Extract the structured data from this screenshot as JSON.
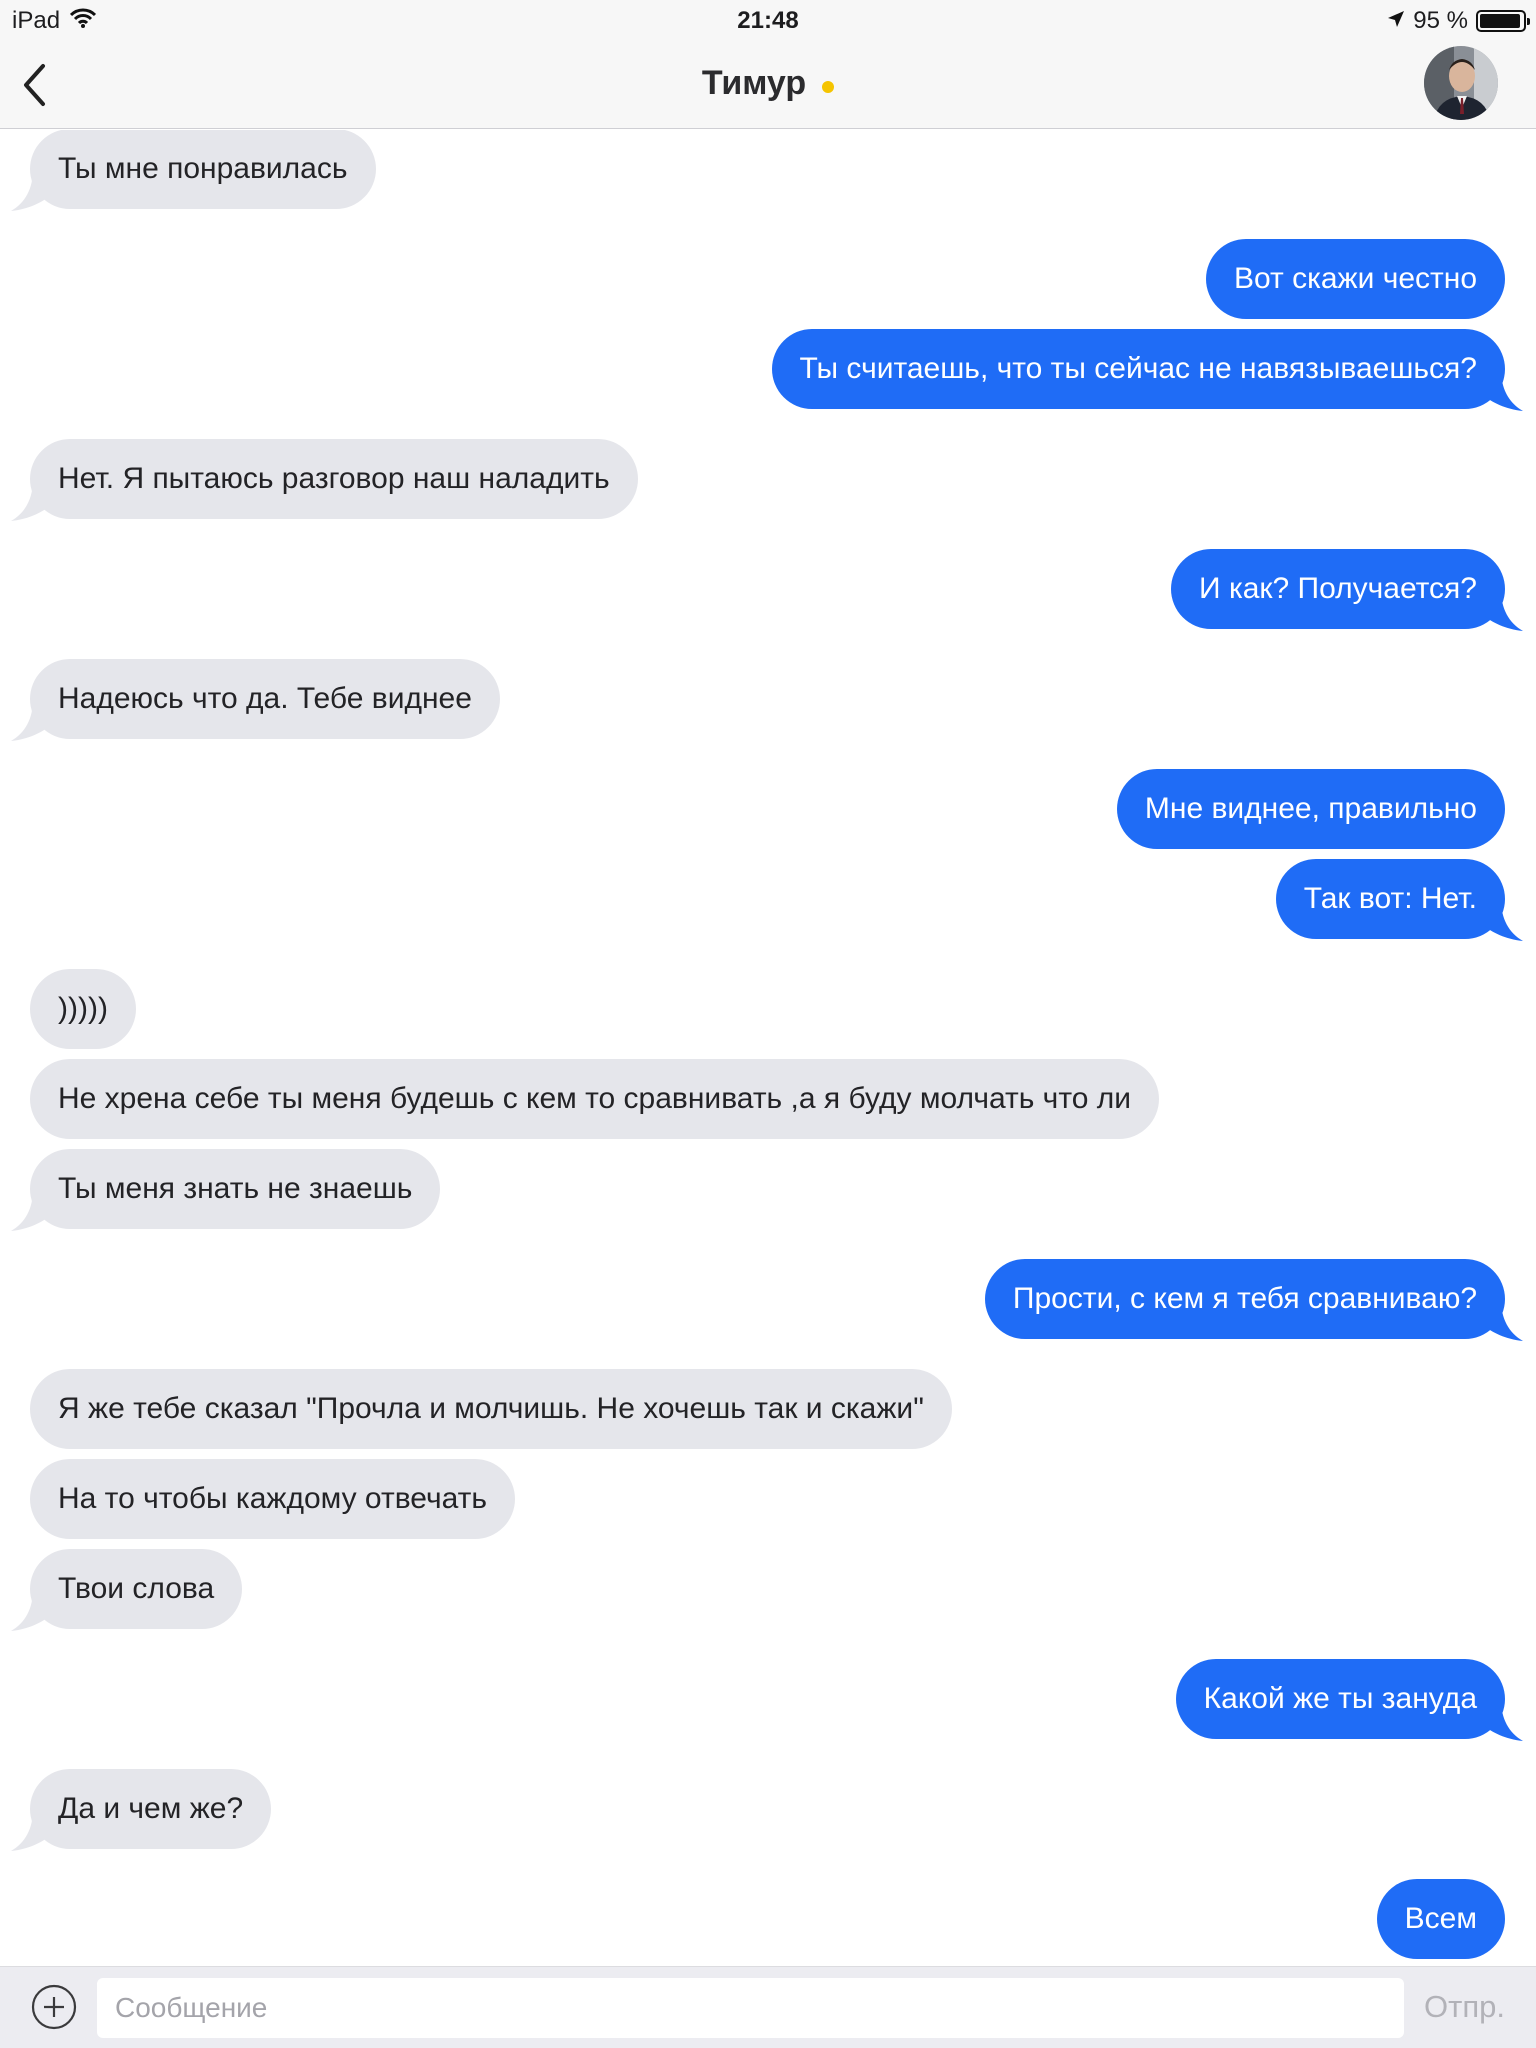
{
  "status_bar": {
    "device": "iPad",
    "time": "21:48",
    "battery_percent_label": "95 %",
    "battery_level": 0.95
  },
  "header": {
    "contact_name": "Тимур",
    "online_status_color": "#f5c400",
    "back_icon": "chevron-left-icon",
    "avatar": "contact-avatar"
  },
  "colors": {
    "incoming_bubble": "#e5e6eb",
    "outgoing_bubble": "#1f6cf6"
  },
  "messages": [
    {
      "dir": "in",
      "text": "Ты мне понравилась",
      "tail": true
    },
    {
      "dir": "out",
      "text": "Вот скажи честно",
      "tail": false
    },
    {
      "dir": "out",
      "text": "Ты считаешь, что ты сейчас не навязываешься?",
      "tail": true
    },
    {
      "dir": "in",
      "text": "Нет. Я пытаюсь разговор наш наладить",
      "tail": true
    },
    {
      "dir": "out",
      "text": "И как? Получается?",
      "tail": true
    },
    {
      "dir": "in",
      "text": "Надеюсь что да. Тебе виднее",
      "tail": true
    },
    {
      "dir": "out",
      "text": "Мне виднее, правильно",
      "tail": false
    },
    {
      "dir": "out",
      "text": "Так вот: Нет.",
      "tail": true
    },
    {
      "dir": "in",
      "text": ")))))",
      "tail": false
    },
    {
      "dir": "in",
      "text": "Не хрена себе ты меня будешь с кем то сравнивать ,а я буду молчать что ли",
      "tail": false
    },
    {
      "dir": "in",
      "text": "Ты меня знать не знаешь",
      "tail": true
    },
    {
      "dir": "out",
      "text": "Прости, с кем я тебя сравниваю?",
      "tail": true
    },
    {
      "dir": "in",
      "text": "Я же тебе сказал \"Прочла и молчишь. Не хочешь так и скажи\"",
      "tail": false
    },
    {
      "dir": "in",
      "text": "На то чтобы каждому отвечать",
      "tail": false
    },
    {
      "dir": "in",
      "text": "Твои слова",
      "tail": true
    },
    {
      "dir": "out",
      "text": "Какой же ты зануда",
      "tail": true
    },
    {
      "dir": "in",
      "text": "Да и чем же?",
      "tail": true
    },
    {
      "dir": "out",
      "text": "Всем",
      "tail": false
    }
  ],
  "composer": {
    "placeholder": "Сообщение",
    "send_label": "Отпр.",
    "attach_icon": "plus-circle-icon"
  }
}
